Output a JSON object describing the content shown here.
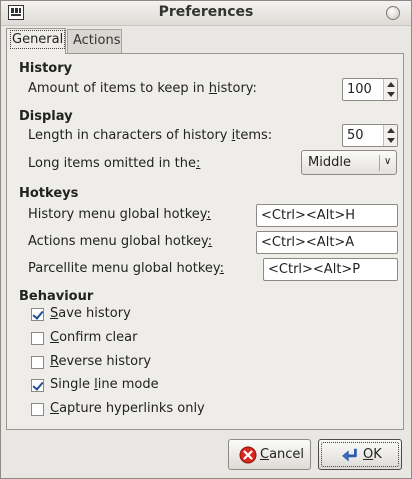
{
  "window": {
    "title": "Preferences"
  },
  "tabs": [
    {
      "label": "General",
      "active": true
    },
    {
      "label": "Actions",
      "active": false
    }
  ],
  "history": {
    "heading": "History",
    "items_label_pre": "Amount of items to keep in ",
    "items_label_ul": "h",
    "items_label_post": "istory:",
    "items_value": "100"
  },
  "display": {
    "heading": "Display",
    "length_label_pre": "Length in characters of history ",
    "length_label_ul": "i",
    "length_label_post": "tems:",
    "length_value": "50",
    "omit_label_pre": "Long items omitted in the",
    "omit_label_ul": ":",
    "omit_label_post": "",
    "omit_value": "Middle"
  },
  "hotkeys": {
    "heading": "Hotkeys",
    "history_label_pre": "History menu global hotkey",
    "history_label_ul": ":",
    "history_value": "<Ctrl><Alt>H",
    "actions_label_pre": "Actions menu global hotkey",
    "actions_label_ul": ":",
    "actions_value": "<Ctrl><Alt>A",
    "parcellite_label_pre": "Parcellite menu global hotkey",
    "parcellite_label_ul": ":",
    "parcellite_value": "<Ctrl><Alt>P"
  },
  "behaviour": {
    "heading": "Behaviour",
    "options": [
      {
        "ul": "S",
        "rest": "ave history",
        "checked": true
      },
      {
        "ul": "C",
        "rest": "onfirm clear",
        "checked": false
      },
      {
        "ul": "R",
        "rest": "everse history",
        "checked": false
      },
      {
        "pre": "Single ",
        "ul": "l",
        "rest": "ine mode",
        "checked": true
      },
      {
        "ul": "C",
        "rest": "apture hyperlinks only",
        "checked": false
      }
    ]
  },
  "buttons": {
    "cancel_ul": "C",
    "cancel_rest": "ancel",
    "ok_ul": "O",
    "ok_rest": "K"
  },
  "colors": {
    "check": "#1f4f93",
    "cancel_icon": "#d9261c",
    "ok_icon": "#3b6fc4"
  }
}
